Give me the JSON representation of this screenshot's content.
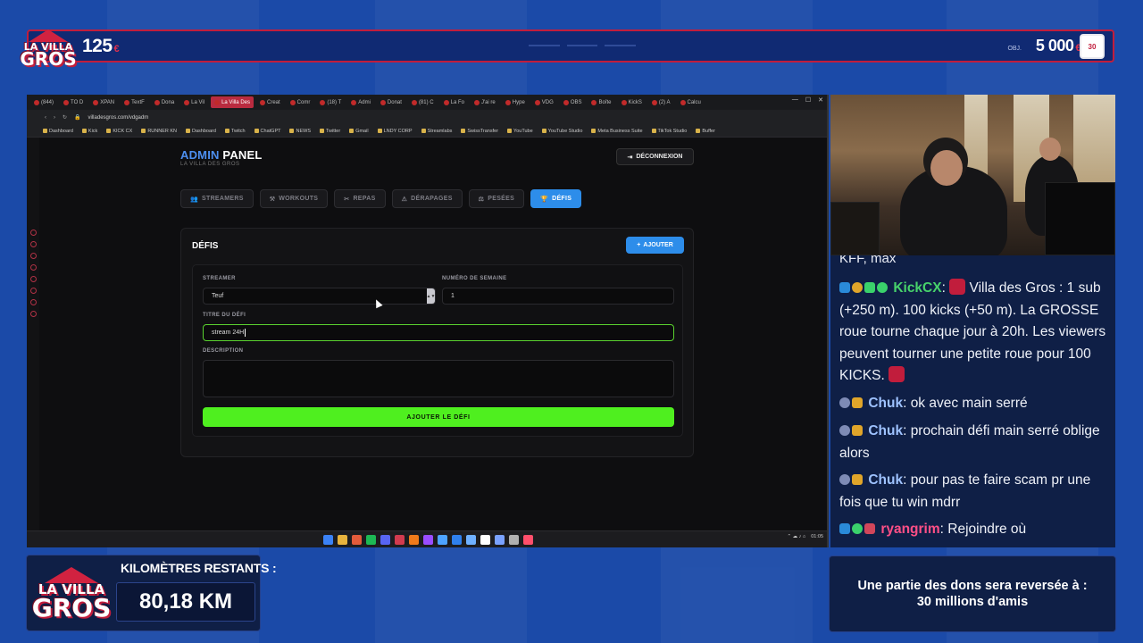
{
  "overlay": {
    "logo_line1": "LA VILLA",
    "logo_line2": "GROS",
    "coins_left": "125",
    "coins_right": "5 000",
    "objective_label": "OBJ.",
    "coin_symbol": "€",
    "km_label": "KILOMÈTRES RESTANTS :",
    "km_value": "80,18 KM",
    "donation_line1": "Une partie des dons sera reversée à :",
    "donation_line2": "30 millions d'amis",
    "colors": {
      "accent_red": "#c11d3c",
      "bg_blue": "#1b4aa8",
      "panel_navy": "#0f1f46"
    }
  },
  "browser": {
    "tabs": [
      "(844)",
      "TO D",
      "XPAN",
      "TextF",
      "Dona",
      "La Vil",
      "La Villa Des",
      "Creat",
      "Comr",
      "(18) T",
      "Admi",
      "Donat",
      "(81) C",
      "La Fo",
      "J'ai re",
      "Hype",
      "VDG",
      "OBS",
      "Boîte",
      "KickS",
      "(2) A",
      "Calcu"
    ],
    "active_tab_index": 6,
    "url": "villadesgros.com/vdgadm",
    "bookmarks": [
      "Dashboard",
      "Kick",
      "KICK CX",
      "RUNNER KN",
      "Dashboard",
      "Twitch",
      "ChatGPT",
      "NEWS",
      "Twitter",
      "Gmail",
      "LNDY CORP",
      "Streamlabs",
      "SwissTransfer",
      "YouTube",
      "YouTube Studio",
      "Meta Business Suite",
      "TikTok Studio",
      "Buffer"
    ],
    "clock": "01:05"
  },
  "admin": {
    "title_accent": "ADMIN",
    "title_rest": "PANEL",
    "subtitle": "LA VILLA DES GROS",
    "logout": "DÉCONNEXION",
    "nav": [
      {
        "label": "STREAMERS",
        "icon": "users-icon"
      },
      {
        "label": "WORKOUTS",
        "icon": "dumbbell-icon"
      },
      {
        "label": "REPAS",
        "icon": "utensils-icon"
      },
      {
        "label": "DÉRAPAGES",
        "icon": "warning-icon"
      },
      {
        "label": "PESÉES",
        "icon": "scale-icon"
      },
      {
        "label": "DÉFIS",
        "icon": "trophy-icon"
      }
    ],
    "active_nav": "DÉFIS",
    "card_title": "DÉFIS",
    "add_button": "AJOUTER",
    "form": {
      "streamer_label": "STREAMER",
      "streamer_value": "Teuf",
      "week_label": "NUMÉRO DE SEMAINE",
      "week_value": "1",
      "title_label": "TITRE DU DÉFI",
      "title_value": "stream 24H",
      "description_label": "DESCRIPTION",
      "description_value": "",
      "submit": "AJOUTER LE DÉFI"
    }
  },
  "chat": {
    "cut_line": "KFF, max",
    "messages": [
      {
        "user": "KickCX",
        "user_color": "#47d26b",
        "text": "Villa des Gros : 1 sub (+250 m). 100 kicks (+50 m). La GROSSE roue tourne chaque jour à 20h. Les viewers peuvent tourner une petite roue pour 100 KICKS."
      },
      {
        "user": "Chuk",
        "user_color": "#9ec2ff",
        "text": "ok avec main serré"
      },
      {
        "user": "Chuk",
        "user_color": "#9ec2ff",
        "text": "prochain défi main serré oblige alors"
      },
      {
        "user": "Chuk",
        "user_color": "#9ec2ff",
        "text": "pour pas te faire scam pr une fois que tu win mdrr"
      },
      {
        "user": "ryangrim",
        "user_color": "#ff4f86",
        "text": "Rejoindre où"
      }
    ]
  }
}
